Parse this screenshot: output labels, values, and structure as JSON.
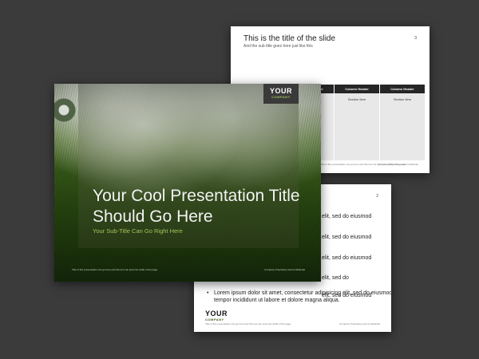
{
  "colors": {
    "background": "#3b3b3b",
    "accent_green": "#3f5a1a",
    "subtitle_green": "#a6c25a",
    "table_header": "#262626"
  },
  "slide_table": {
    "title": "This is the title of the slide",
    "subtitle": "And the sub title goes here just like this",
    "page_number": "3",
    "columns": [
      "Column Header",
      "Column Header",
      "Column Header",
      "Column Header"
    ],
    "section_item": "Section Item",
    "footer_left": "Title of this presentation can go here and this text can span the width of the page",
    "footer_right": "Company Proprietary and Confidential"
  },
  "slide_bullets": {
    "page_number": "2",
    "bullet_fragments": [
      "elit, sed do eiusmod",
      "elit, sed do eiusmod",
      "elit, sed do eiusmod",
      "elit, sed do",
      "elit, sed do eiusmod"
    ],
    "last_bullet_line1": "Lorem ipsum dolor sit amet, consectetur adipisicing elit, sed do eiusmod",
    "last_bullet_line2": "tempor incididunt ut labore et dolore magna aliqua.",
    "logo_line1": "YOUR",
    "logo_line2": "COMPANY",
    "footer_left": "Title of this presentation can go here and this text can span the width of the page",
    "footer_right": "Company Proprietary and Confidential"
  },
  "slide_title": {
    "title_line1": "Your Cool Presentation Title",
    "title_line2": "Should Go Here",
    "subtitle": "Your Sub-Title Can Go Right Here",
    "logo_line1": "YOUR",
    "logo_line2": "COMPANY",
    "footer_left": "Title of this presentation can go here and this text can span the width of the page",
    "footer_right": "Company Proprietary and Confidential"
  }
}
